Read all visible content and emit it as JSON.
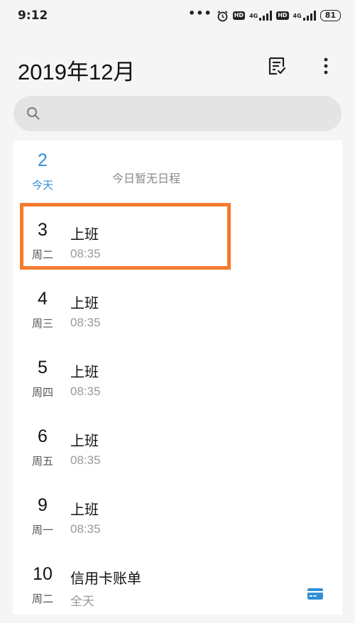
{
  "status_bar": {
    "time": "9:12",
    "dots": "•••",
    "hd1": "HD",
    "net1": "4G",
    "hd2": "HD",
    "net2": "4G",
    "battery": "81"
  },
  "header": {
    "title": "2019年12月",
    "note_icon": "checklist-icon",
    "more_icon": "more-vertical-icon"
  },
  "search": {
    "placeholder": "",
    "icon": "search-icon"
  },
  "agenda": {
    "today": {
      "day": "2",
      "weekday": "今天",
      "empty_text": "今日暂无日程"
    },
    "rows": [
      {
        "day": "3",
        "weekday": "周二",
        "title": "上班",
        "time": "08:35"
      },
      {
        "day": "4",
        "weekday": "周三",
        "title": "上班",
        "time": "08:35"
      },
      {
        "day": "5",
        "weekday": "周四",
        "title": "上班",
        "time": "08:35"
      },
      {
        "day": "6",
        "weekday": "周五",
        "title": "上班",
        "time": "08:35"
      },
      {
        "day": "9",
        "weekday": "周一",
        "title": "上班",
        "time": "08:35"
      },
      {
        "day": "10",
        "weekday": "周二",
        "title": "信用卡账单",
        "time": "全天",
        "icon": "credit-card-icon"
      }
    ]
  },
  "colors": {
    "accent": "#2f8fd6",
    "highlight": "#f47a30",
    "background": "#f5f5f5",
    "card": "#ffffff"
  }
}
